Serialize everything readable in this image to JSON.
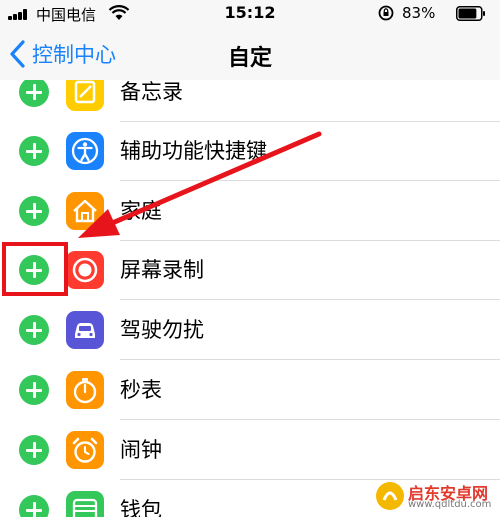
{
  "status_bar": {
    "carrier": "中国电信",
    "time": "15:12",
    "battery_percent": "83%",
    "battery_level": 0.83
  },
  "nav": {
    "back_label": "控制中心",
    "title": "自定"
  },
  "list": {
    "items": [
      {
        "label": "备忘录",
        "icon": "notes-icon",
        "icon_color": "#ffcc00"
      },
      {
        "label": "辅助功能快捷键",
        "icon": "accessibility-icon",
        "icon_color": "#1a82fb"
      },
      {
        "label": "家庭",
        "icon": "home-icon",
        "icon_color": "#ff9500"
      },
      {
        "label": "屏幕录制",
        "icon": "screen-recording-icon",
        "icon_color": "#ff3b30"
      },
      {
        "label": "驾驶勿扰",
        "icon": "car-icon",
        "icon_color": "#5856d6"
      },
      {
        "label": "秒表",
        "icon": "stopwatch-icon",
        "icon_color": "#ff9500"
      },
      {
        "label": "闹钟",
        "icon": "alarm-clock-icon",
        "icon_color": "#ff9500"
      },
      {
        "label": "钱包",
        "icon": "wallet-icon",
        "icon_color": "#34c759"
      }
    ]
  },
  "annotation": {
    "color": "#e8141c"
  },
  "watermark": {
    "text": "启东安卓网",
    "url": "www.qdltdu.com"
  }
}
